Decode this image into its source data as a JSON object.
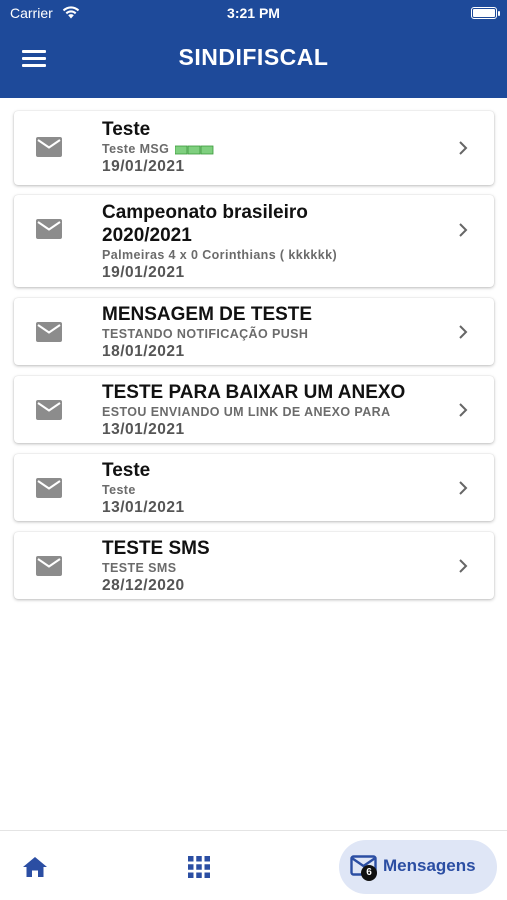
{
  "status_bar": {
    "carrier": "Carrier",
    "time": "3:21 PM"
  },
  "header": {
    "title": "SINDIFISCAL",
    "background": "#1e4a9a"
  },
  "messages": [
    {
      "title": "Teste",
      "subtitle": "Teste MSG",
      "date": "19/01/2021"
    },
    {
      "title": "Campeonato brasileiro 2020/2021",
      "subtitle": "Palmeiras 4 x 0 Corinthians ( kkkkkk)",
      "date": "19/01/2021"
    },
    {
      "title": "MENSAGEM DE TESTE",
      "subtitle": "TESTANDO NOTIFICAÇÃO PUSH",
      "date": "18/01/2021"
    },
    {
      "title": "TESTE PARA BAIXAR UM ANEXO",
      "subtitle": "ESTOU ENVIANDO UM LINK DE ANEXO PARA",
      "date": "13/01/2021"
    },
    {
      "title": "Teste",
      "subtitle": "Teste",
      "date": "13/01/2021"
    },
    {
      "title": "TESTE SMS",
      "subtitle": "TESTE SMS",
      "date": "28/12/2020"
    }
  ],
  "bottom_nav": {
    "home_icon": "home-icon",
    "apps_icon": "grid-icon",
    "messages_label": "Mensagens",
    "messages_badge": "6",
    "accent": "#2b4ea3"
  }
}
